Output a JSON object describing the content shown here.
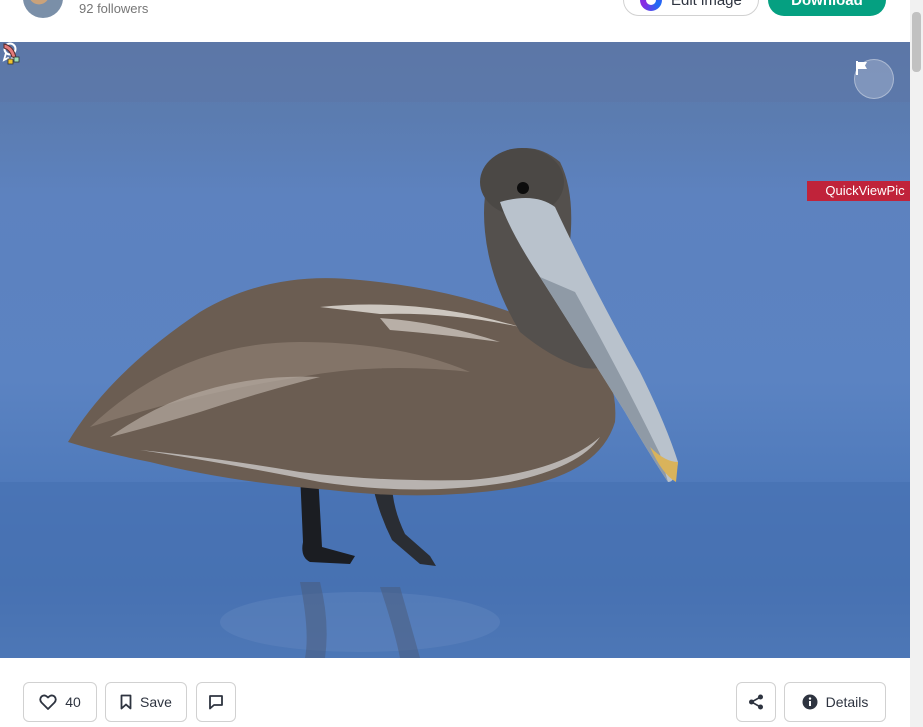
{
  "header": {
    "followers_text": "92 followers",
    "edit_image_label": "Edit image",
    "download_label": "Download"
  },
  "overlay": {
    "quickview_label": "QuickViewPic"
  },
  "actions": {
    "like_count": "40",
    "save_label": "Save",
    "details_label": "Details"
  },
  "icons": {
    "award": "award-icon",
    "flag": "flag-icon",
    "heart": "heart-icon",
    "bookmark": "bookmark-icon",
    "comment": "comment-icon",
    "share": "share-icon",
    "info": "info-icon",
    "cursor": "pointer-cursor-icon"
  },
  "colors": {
    "download": "#05a081",
    "quickview": "#c0233a"
  }
}
